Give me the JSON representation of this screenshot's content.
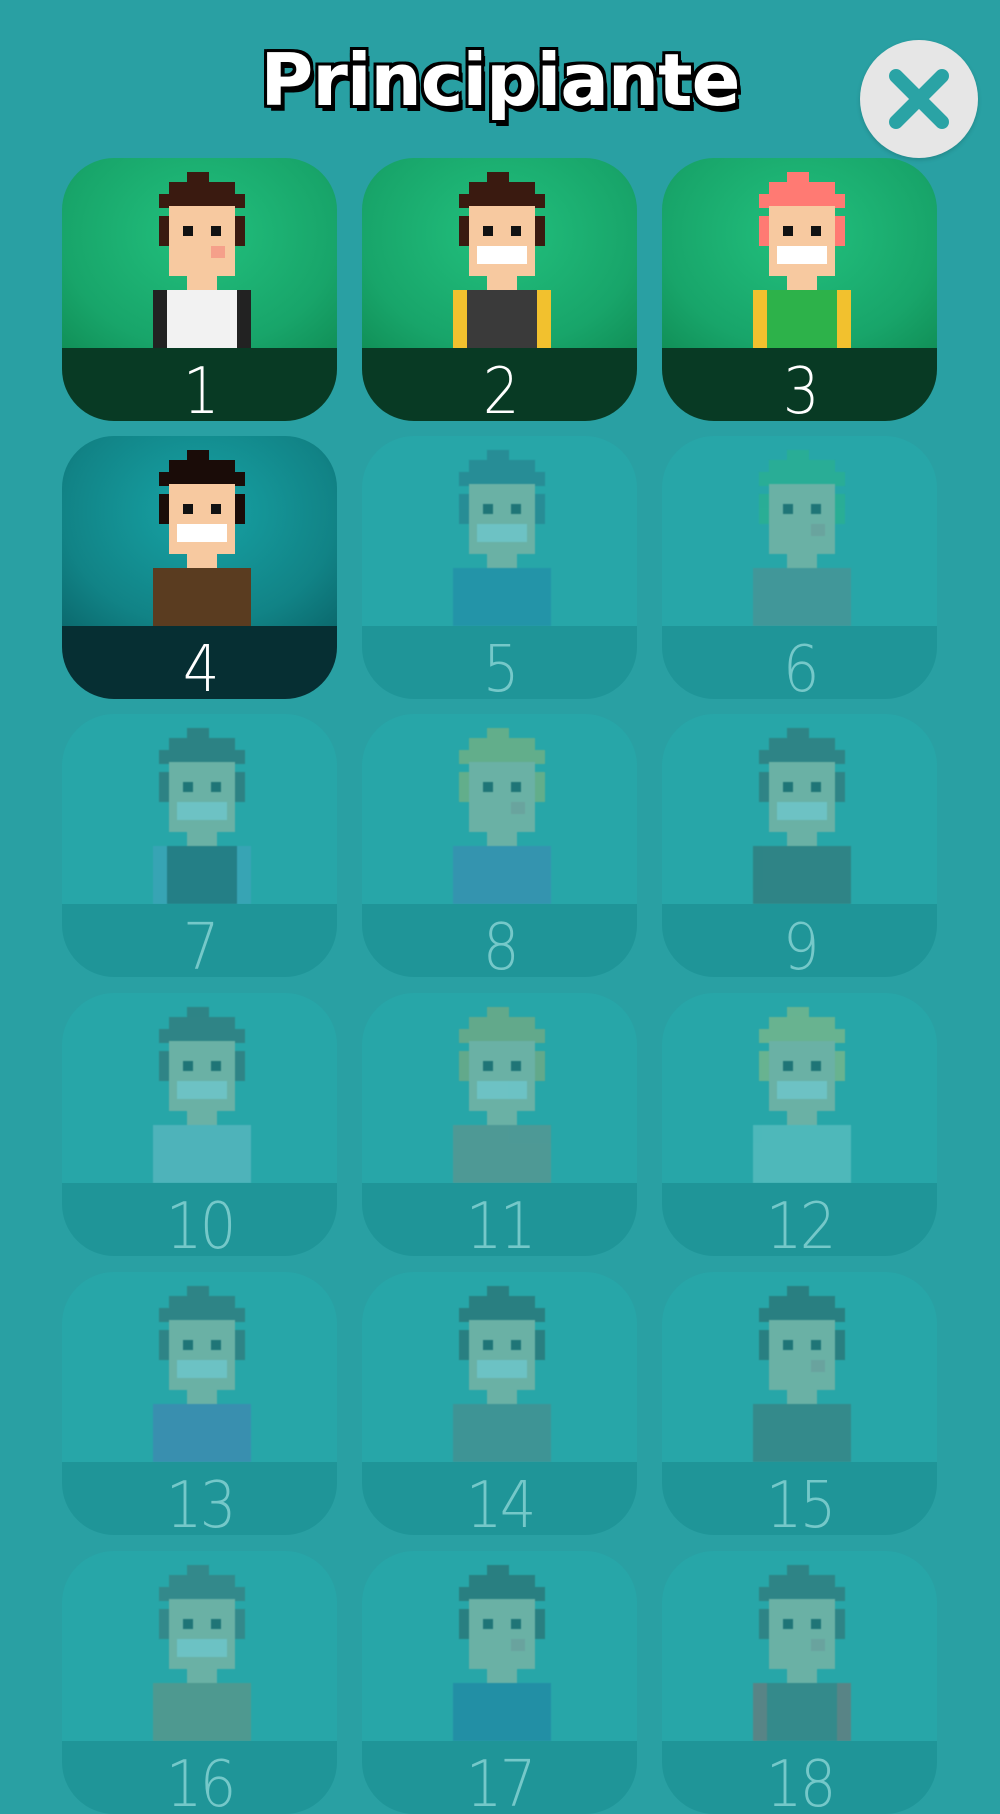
{
  "screen": {
    "title": "Principiante",
    "close_icon": "close-icon"
  },
  "levels": [
    {
      "label": "1",
      "state": "completed",
      "hair": "#3a1a10",
      "shirt": "#f2f2f2",
      "accent": "#222222",
      "smile": false
    },
    {
      "label": "2",
      "state": "completed",
      "hair": "#3a1a10",
      "shirt": "#3a3a3a",
      "accent": "#f2c12e",
      "smile": true
    },
    {
      "label": "3",
      "state": "completed",
      "hair": "#ff7a73",
      "shirt": "#2db24a",
      "accent": "#f2c12e",
      "smile": true
    },
    {
      "label": "4",
      "state": "current",
      "hair": "#1a0c08",
      "shirt": "#5a3c20",
      "accent": "#5a3c20",
      "smile": true
    },
    {
      "label": "5",
      "state": "locked",
      "hair": "#2a5a70",
      "shirt": "#1d6fa8",
      "accent": "#1d6fa8",
      "smile": true
    },
    {
      "label": "6",
      "state": "locked",
      "hair": "#2fbf70",
      "shirt": "#7a7a7a",
      "accent": "#7a7a7a",
      "smile": false
    },
    {
      "label": "7",
      "state": "locked",
      "hair": "#3a3a3a",
      "shirt": "#203040",
      "accent": "#5aa0d0",
      "smile": true
    },
    {
      "label": "8",
      "state": "locked",
      "hair": "#e0c050",
      "shirt": "#5070c0",
      "accent": "#5070c0",
      "smile": false
    },
    {
      "label": "9",
      "state": "locked",
      "hair": "#404040",
      "shirt": "#404040",
      "accent": "#404040",
      "smile": true
    },
    {
      "label": "10",
      "state": "locked",
      "hair": "#404040",
      "shirt": "#a0d0e0",
      "accent": "#a0d0e0",
      "smile": true
    },
    {
      "label": "11",
      "state": "locked",
      "hair": "#e0b050",
      "shirt": "#a08070",
      "accent": "#a08070",
      "smile": true
    },
    {
      "label": "12",
      "state": "locked",
      "hair": "#f0d060",
      "shirt": "#a0e0e0",
      "accent": "#a0e0e0",
      "smile": true
    },
    {
      "label": "13",
      "state": "locked",
      "hair": "#404040",
      "shirt": "#6060c0",
      "accent": "#6060c0",
      "smile": true
    },
    {
      "label": "14",
      "state": "locked",
      "hair": "#303030",
      "shirt": "#707070",
      "accent": "#707070",
      "smile": true
    },
    {
      "label": "15",
      "state": "locked",
      "hair": "#303030",
      "shirt": "#505050",
      "accent": "#505050",
      "smile": false
    },
    {
      "label": "16",
      "state": "locked",
      "hair": "#505050",
      "shirt": "#a08060",
      "accent": "#a08060",
      "smile": true
    },
    {
      "label": "17",
      "state": "locked",
      "hair": "#303030",
      "shirt": "#1a60a0",
      "accent": "#1a60a0",
      "smile": false
    },
    {
      "label": "18",
      "state": "locked",
      "hair": "#404040",
      "shirt": "#505050",
      "accent": "#c04040",
      "smile": false
    }
  ]
}
